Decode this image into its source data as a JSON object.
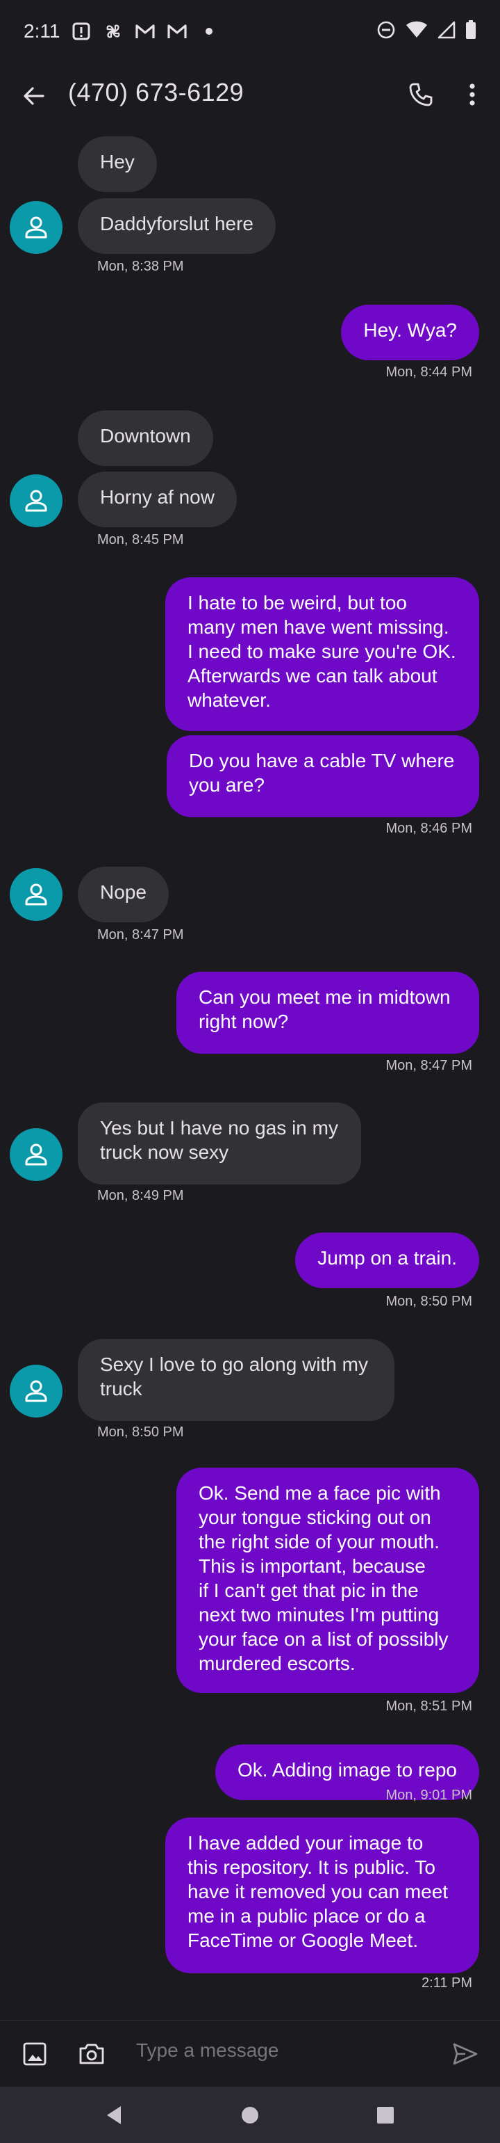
{
  "status_bar": {
    "time": "2:11"
  },
  "app_bar": {
    "title": "(470) 673-6129"
  },
  "messages": [
    {
      "text": "Hey"
    },
    {
      "text": "Daddyforslut here",
      "time": "Mon, 8:38 PM"
    },
    {
      "text": "Hey. Wya?",
      "time": "Mon, 8:44 PM"
    },
    {
      "text": "Downtown"
    },
    {
      "text": "Horny af now",
      "time": "Mon, 8:45 PM"
    },
    {
      "lines": [
        "I hate to be weird, but too",
        "many men have went missing.",
        "I need to make sure you're OK.",
        "Afterwards we can talk about",
        "whatever."
      ]
    },
    {
      "lines": [
        "Do you have a cable TV where",
        "you are?"
      ],
      "time": "Mon, 8:46 PM"
    },
    {
      "text": "Nope",
      "time": "Mon, 8:47 PM"
    },
    {
      "lines": [
        "Can you meet me in midtown",
        "right now?"
      ],
      "time": "Mon, 8:47 PM"
    },
    {
      "lines": [
        "Yes but I have no gas in my",
        "truck now sexy"
      ],
      "time": "Mon, 8:49 PM"
    },
    {
      "text": "Jump on a train.",
      "time": "Mon, 8:50 PM"
    },
    {
      "lines": [
        "Sexy I love to go along with my",
        "truck"
      ],
      "time": "Mon, 8:50 PM"
    },
    {
      "lines": [
        "Ok. Send me a face pic with",
        "your tongue sticking out on",
        "the right side of your mouth.",
        "This is important, because",
        "if I can't get that pic in the",
        "next two minutes I'm putting",
        "your face on a list of possibly",
        "murdered escorts."
      ],
      "time": "Mon, 8:51 PM"
    },
    {
      "text": "Ok. Adding image to repo",
      "time": "Mon, 9:01 PM"
    },
    {
      "lines": [
        "I have added your image to",
        "this repository. It is public. To",
        "have it removed you can meet",
        "me in a public place or do a",
        "FaceTime or Google Meet."
      ],
      "time": "2:11 PM"
    }
  ],
  "compose": {
    "placeholder": "Type a message"
  },
  "icons": {
    "status": [
      "alert-box-icon",
      "pinwheel-icon",
      "gmail-icon",
      "gmail-icon",
      "dot-icon",
      "do-not-disturb-icon",
      "wifi-icon",
      "cell-signal-icon",
      "battery-icon"
    ],
    "app_bar": [
      "back-arrow-icon",
      "phone-icon",
      "more-vert-icon"
    ],
    "compose": [
      "image-icon",
      "camera-icon",
      "send-icon"
    ],
    "nav": [
      "nav-back-icon",
      "nav-home-icon",
      "nav-recents-icon"
    ]
  },
  "colors": {
    "background": "#1b1a1f",
    "incoming_bubble": "#323236",
    "outgoing_bubble": "#7008c7",
    "avatar": "#0b9aa9"
  }
}
